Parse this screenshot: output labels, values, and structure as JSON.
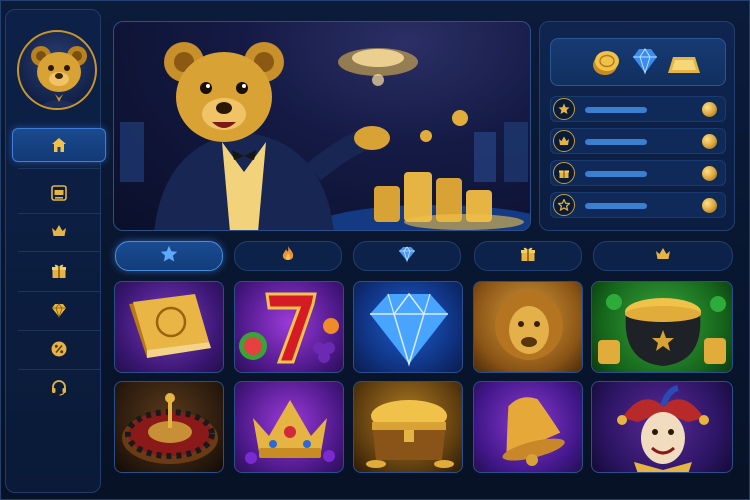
{
  "colors": {
    "background": "#071226",
    "panel": "#0d2148",
    "accent_blue": "#3f7dd6",
    "gold": "#d8a23a",
    "stat_bar": "#3b7fd2"
  },
  "sidebar": {
    "avatar": "bear-mascot-avatar",
    "items": [
      {
        "icon": "home-icon",
        "active": true
      },
      {
        "icon": "slot-machine-icon",
        "active": false
      },
      {
        "icon": "crown-icon",
        "active": false
      },
      {
        "icon": "gift-icon",
        "active": false
      },
      {
        "icon": "diamond-icon",
        "active": false
      },
      {
        "icon": "percent-badge-icon",
        "active": false
      },
      {
        "icon": "headset-icon",
        "active": false
      }
    ]
  },
  "hero": {
    "image": "bear-mascot-casino-banner"
  },
  "wallet": {
    "currencies": [
      "gold-coins-icon",
      "blue-gem-icon",
      "gold-bar-icon"
    ],
    "stats": [
      {
        "icon": "star-icon",
        "fill": 0.6
      },
      {
        "icon": "crown-icon",
        "fill": 0.6
      },
      {
        "icon": "gift-icon",
        "fill": 0.6
      },
      {
        "icon": "star-icon",
        "fill": 0.6
      }
    ]
  },
  "tabs": [
    {
      "icon": "star-icon",
      "active": true
    },
    {
      "icon": "flame-icon",
      "active": false
    },
    {
      "icon": "diamond-icon",
      "active": false
    },
    {
      "icon": "gift-icon",
      "active": false
    },
    {
      "icon": "crown-icon",
      "active": false
    }
  ],
  "games": [
    {
      "name": "golden-book-game"
    },
    {
      "name": "fruit-seven-game"
    },
    {
      "name": "blue-diamond-game"
    },
    {
      "name": "golden-lion-game"
    },
    {
      "name": "pot-of-gold-game"
    },
    {
      "name": "roulette-game"
    },
    {
      "name": "royal-crown-game"
    },
    {
      "name": "treasure-chest-game"
    },
    {
      "name": "golden-bell-game"
    },
    {
      "name": "jester-game"
    }
  ]
}
